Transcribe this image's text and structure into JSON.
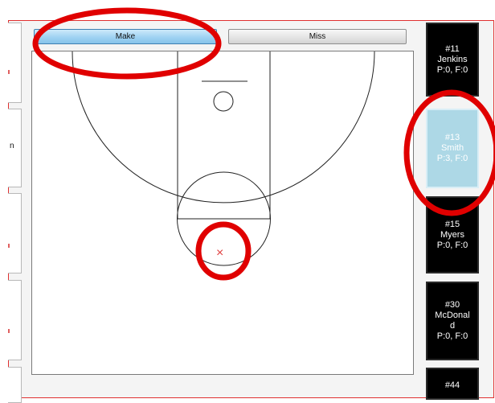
{
  "buttons": {
    "make_label": "Make",
    "miss_label": "Miss"
  },
  "left_panel": {
    "item_letter": "n"
  },
  "players": [
    {
      "number": "#11",
      "name": "Jenkins",
      "stats": "P:0, F:0",
      "selected": false
    },
    {
      "number": "#13",
      "name": "Smith",
      "stats": "P:3, F:0",
      "selected": true
    },
    {
      "number": "#15",
      "name": "Myers",
      "stats": "P:0, F:0",
      "selected": false
    },
    {
      "number": "#30",
      "name_line1": "McDonal",
      "name_line2": "d",
      "stats": "P:0, F:0",
      "selected": false
    },
    {
      "number": "#44"
    }
  ],
  "shot_marker": {
    "symbol": "×",
    "color": "#e04040"
  },
  "colors": {
    "annotation_red": "#e00000",
    "selected_player_bg": "#add8e6",
    "player_bg": "#000000",
    "make_button": "#9fd2f2"
  }
}
